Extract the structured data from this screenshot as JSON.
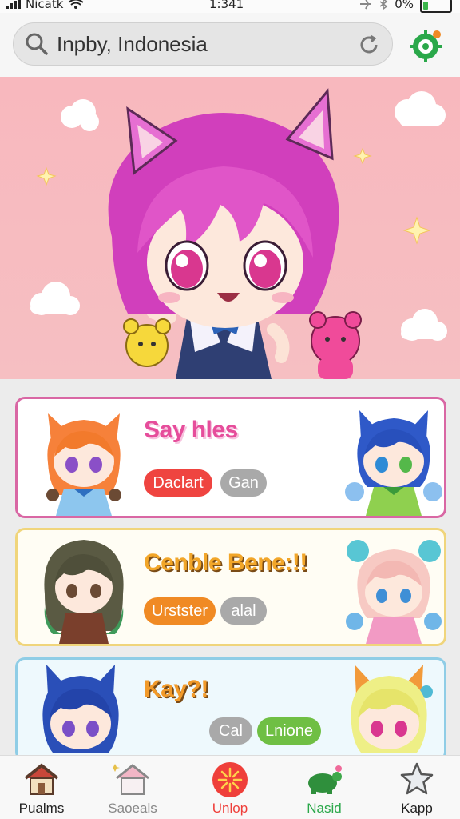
{
  "status_bar": {
    "carrier": "Nicatk",
    "time": "1:341",
    "battery": "0%"
  },
  "search": {
    "value": "Inpby, Indonesia",
    "placeholder": "Inpby, Indonesia"
  },
  "colors": {
    "accent_green": "#2aa84a",
    "accent_red": "#ef3f3a",
    "hero_pink": "#f8b8be"
  },
  "cards": [
    {
      "title": "Say hles",
      "chips": [
        {
          "label": "Daclart",
          "color": "#ef4440"
        },
        {
          "label": "Gan",
          "color": "#a9a9a9"
        }
      ]
    },
    {
      "title": "Cenble Bene:!!",
      "chips": [
        {
          "label": "Urstster",
          "color": "#f08a24"
        },
        {
          "label": "alal",
          "color": "#a9a9a9"
        }
      ]
    },
    {
      "title": "Kay?!",
      "chips": [
        {
          "label": "Cal",
          "color": "#a9a9a9"
        },
        {
          "label": "Lnione",
          "color": "#6fbf44"
        }
      ]
    }
  ],
  "nav": [
    {
      "label": "Pualms",
      "icon": "house-icon",
      "color": "#222222"
    },
    {
      "label": "Saoeals",
      "icon": "house-outline-icon",
      "color": "#888888"
    },
    {
      "label": "Unlop",
      "icon": "sunburst-icon",
      "color": "#ef3f3a"
    },
    {
      "label": "Nasid",
      "icon": "turtle-icon",
      "color": "#2aa84a"
    },
    {
      "label": "Kapp",
      "icon": "star-icon",
      "color": "#222222"
    }
  ]
}
